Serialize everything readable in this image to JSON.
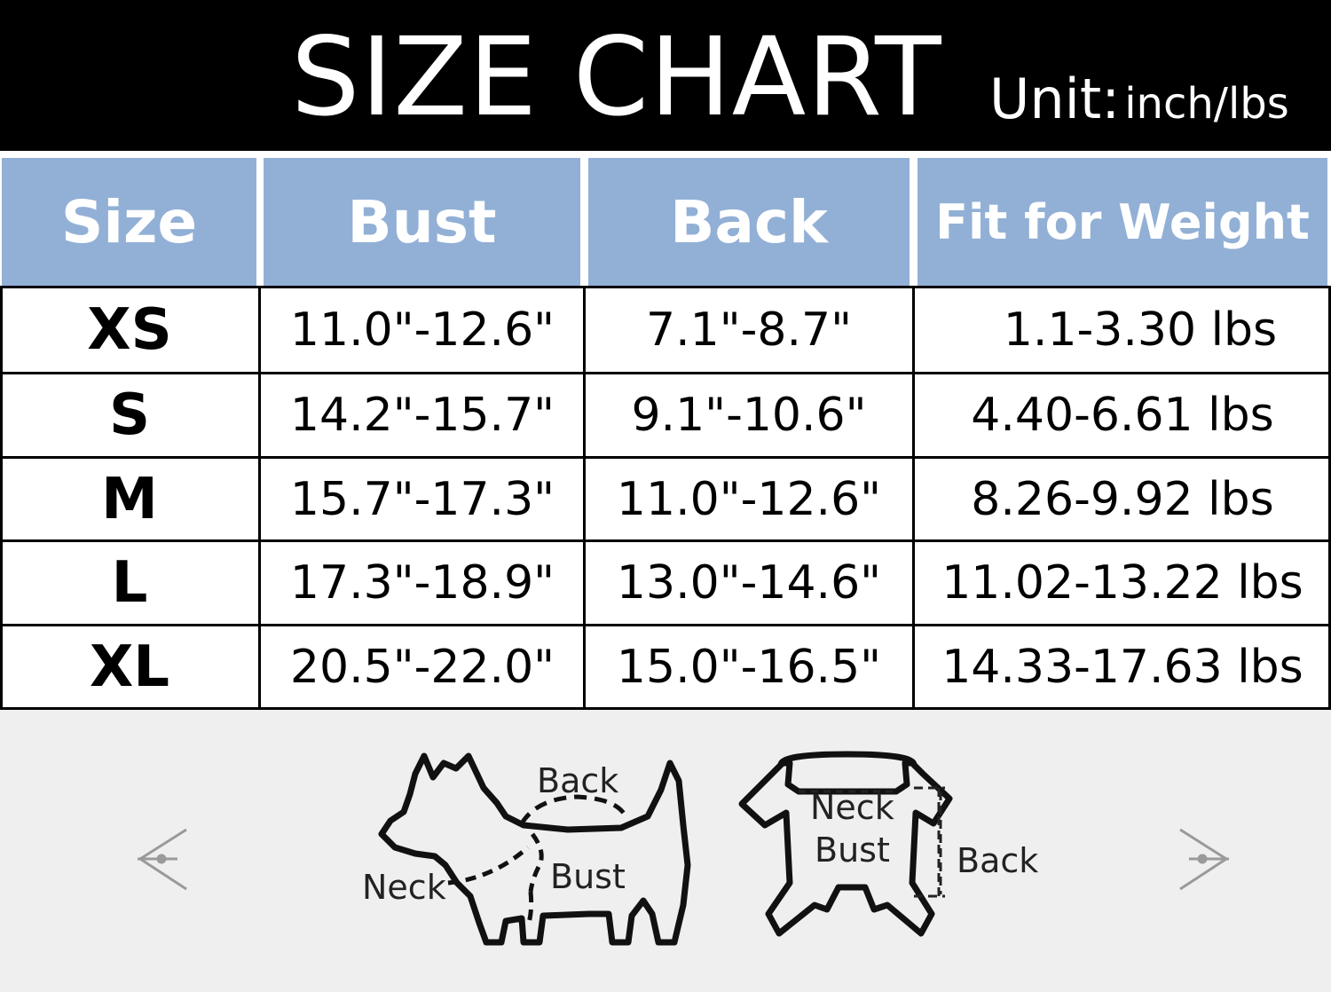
{
  "header": {
    "title": "SIZE CHART",
    "unit_label": "Unit:",
    "unit_value": "inch/lbs"
  },
  "table": {
    "columns": [
      "Size",
      "Bust",
      "Back",
      "Fit for Weight"
    ],
    "rows": [
      {
        "size": "XS",
        "bust": "11.0\"-12.6\"",
        "back": "7.1\"-8.7\"",
        "weight": "1.1-3.30 lbs"
      },
      {
        "size": "S",
        "bust": "14.2\"-15.7\"",
        "back": "9.1\"-10.6\"",
        "weight": "4.40-6.61 lbs"
      },
      {
        "size": "M",
        "bust": "15.7\"-17.3\"",
        "back": "11.0\"-12.6\"",
        "weight": "8.26-9.92 lbs"
      },
      {
        "size": "L",
        "bust": "17.3\"-18.9\"",
        "back": "13.0\"-14.6\"",
        "weight": "11.02-13.22 lbs"
      },
      {
        "size": "XL",
        "bust": "20.5\"-22.0\"",
        "back": "15.0\"-16.5\"",
        "weight": "14.33-17.63 lbs"
      }
    ]
  },
  "diagram": {
    "dog_labels": {
      "back": "Back",
      "neck": "Neck",
      "bust": "Bust"
    },
    "garment_labels": {
      "neck": "Neck",
      "bust": "Bust",
      "back": "Back"
    }
  },
  "colors": {
    "header_bg": "#000000",
    "column_header_bg": "#92b0d6",
    "diagram_bg": "#efefef"
  },
  "icons": [
    "arrow-left-icon",
    "dog-outline-icon",
    "garment-outline-icon",
    "arrow-right-icon"
  ]
}
